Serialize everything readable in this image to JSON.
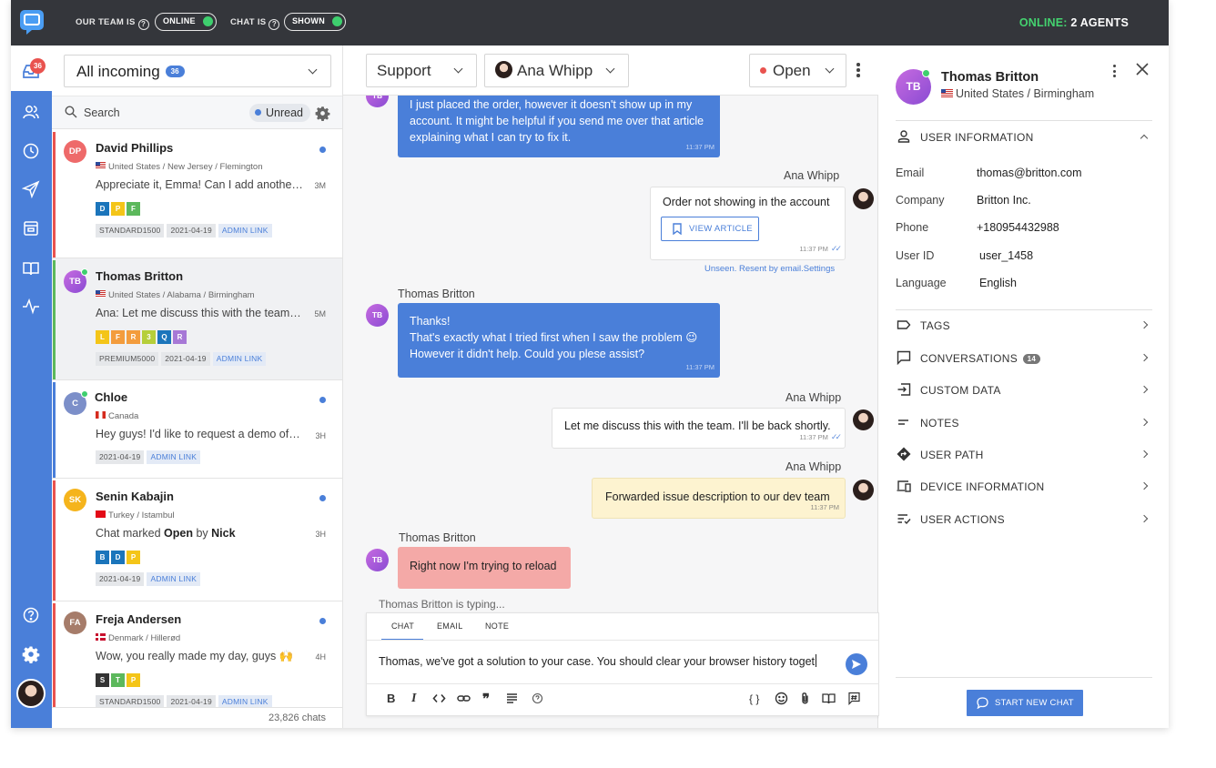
{
  "topbar": {
    "team_label": "OUR TEAM IS",
    "team_toggle": "ONLINE",
    "chat_label": "CHAT IS",
    "chat_toggle": "SHOWN",
    "online_label": "ONLINE:",
    "online_value": "2 AGENTS"
  },
  "nav": {
    "inbox_badge": "36"
  },
  "list": {
    "inbox_name": "All incoming",
    "inbox_count": "36",
    "search_placeholder": "Search",
    "unread_label": "Unread",
    "total": "23,826 chats",
    "conversations": [
      {
        "initials": "DP",
        "name": "David Phillips",
        "location": "United States / New Jersey / Flemington",
        "message": "Appreciate it, Emma! Can I add another item to my order?",
        "time": "3M",
        "tags": [
          {
            "label": "D",
            "color": "#1b75bb"
          },
          {
            "label": "P",
            "color": "#f4c518"
          },
          {
            "label": "F",
            "color": "#5cb85c"
          }
        ],
        "chips": [
          "STANDARD1500",
          "2021-04-19"
        ],
        "link": "ADMIN LINK"
      },
      {
        "initials": "TB",
        "name": "Thomas Britton",
        "location": "United States / Alabama / Birmingham",
        "message": "Ana: Let me discuss this with the team. I'll be back shortly.",
        "time": "5M",
        "tags": [
          {
            "label": "L",
            "color": "#f4c518"
          },
          {
            "label": "F",
            "color": "#f39c3d"
          },
          {
            "label": "R",
            "color": "#f39c3d"
          },
          {
            "label": "3",
            "color": "#b6cf3a"
          },
          {
            "label": "Q",
            "color": "#1b75bb"
          },
          {
            "label": "R",
            "color": "#a778d6"
          }
        ],
        "chips": [
          "PREMIUM5000",
          "2021-04-19"
        ],
        "link": "ADMIN LINK"
      },
      {
        "initials": "C",
        "name": "Chloe",
        "location": "Canada",
        "message": "Hey guys! I'd like to request a demo of your product.",
        "time": "3H",
        "chips": [
          "2021-04-19"
        ],
        "link": "ADMIN LINK"
      },
      {
        "initials": "SK",
        "name": "Senin Kabajin",
        "location": "Turkey / Istambul",
        "message_pre": "Chat marked ",
        "message_status": "Open",
        "message_mid": " by ",
        "message_agent": "Nick",
        "time": "3H",
        "tags": [
          {
            "label": "B",
            "color": "#1b75bb"
          },
          {
            "label": "D",
            "color": "#1b75bb"
          },
          {
            "label": "P",
            "color": "#f4c518"
          }
        ],
        "chips": [
          "2021-04-19"
        ],
        "link": "ADMIN LINK"
      },
      {
        "initials": "FA",
        "name": "Freja Andersen",
        "location": "Denmark / Hillerød",
        "message": "Wow, you really made my day, guys 🙌",
        "time": "4H",
        "tags": [
          {
            "label": "S",
            "color": "#333333"
          },
          {
            "label": "T",
            "color": "#5cb85c"
          },
          {
            "label": "P",
            "color": "#f4c518"
          }
        ],
        "chips": [
          "STANDARD1500",
          "2021-04-19"
        ],
        "link": "ADMIN LINK"
      }
    ]
  },
  "chat": {
    "team": "Support",
    "agent": "Ana Whipp",
    "status": "Open",
    "messages": {
      "m1": "I just placed the order, however it doesn't show up in my account. It might be helpful if you send me over that article explaining what I can try to fix it.",
      "m1_time": "11:37 PM",
      "m2_sender": "Ana Whipp",
      "m2_text": "Order not showing in the account",
      "m2_button": "VIEW ARTICLE",
      "m2_time": "11:37 PM",
      "m2_note": "Unseen. Resent by email.",
      "m2_note_link": "Settings",
      "m3_sender": "Thomas Britton",
      "m3_initials": "TB",
      "m3_line1": "Thanks!",
      "m3_line2": "That's exactly what I tried first when I saw the problem 😉",
      "m3_line3": "However it didn't help. Could you plese assist?",
      "m3_time": "11:37 PM",
      "m4_sender": "Ana Whipp",
      "m4_text": "Let me discuss this with the team. I'll be back shortly.",
      "m4_time": "11:37 PM",
      "m5_sender": "Ana Whipp",
      "m5_text": "Forwarded issue description to our dev team",
      "m5_time": "11:37 PM",
      "m6_sender": "Thomas Britton",
      "m6_initials": "TB",
      "m6_text": "Right now I'm trying to reload"
    },
    "typing": "Thomas Britton is typing...",
    "composer": {
      "tabs": [
        "CHAT",
        "EMAIL",
        "NOTE"
      ],
      "text": "Thomas, we've got a solution to your case. You should clear your browser history toget"
    }
  },
  "profile": {
    "initials": "TB",
    "name": "Thomas Britton",
    "location": "United States / Birmingham",
    "user_info_label": "USER INFORMATION",
    "fields": [
      {
        "key": "Email",
        "value": "thomas@britton.com"
      },
      {
        "key": "Company",
        "value": "Britton Inc."
      },
      {
        "key": "Phone",
        "value": "+180954432988"
      },
      {
        "key": "User ID",
        "value": "user_1458"
      },
      {
        "key": "Language",
        "value": "English"
      }
    ],
    "sections": {
      "tags": "TAGS",
      "conversations": "CONVERSATIONS",
      "conversations_count": "14",
      "custom_data": "CUSTOM DATA",
      "notes": "NOTES",
      "user_path": "USER PATH",
      "device_info": "DEVICE INFORMATION",
      "user_actions": "USER ACTIONS"
    },
    "start_chat": "START NEW CHAT"
  },
  "colors": {
    "accent": "#4a7fd9",
    "topbar": "#34363b",
    "online": "#3ecf6e",
    "alert": "#e9534f"
  }
}
